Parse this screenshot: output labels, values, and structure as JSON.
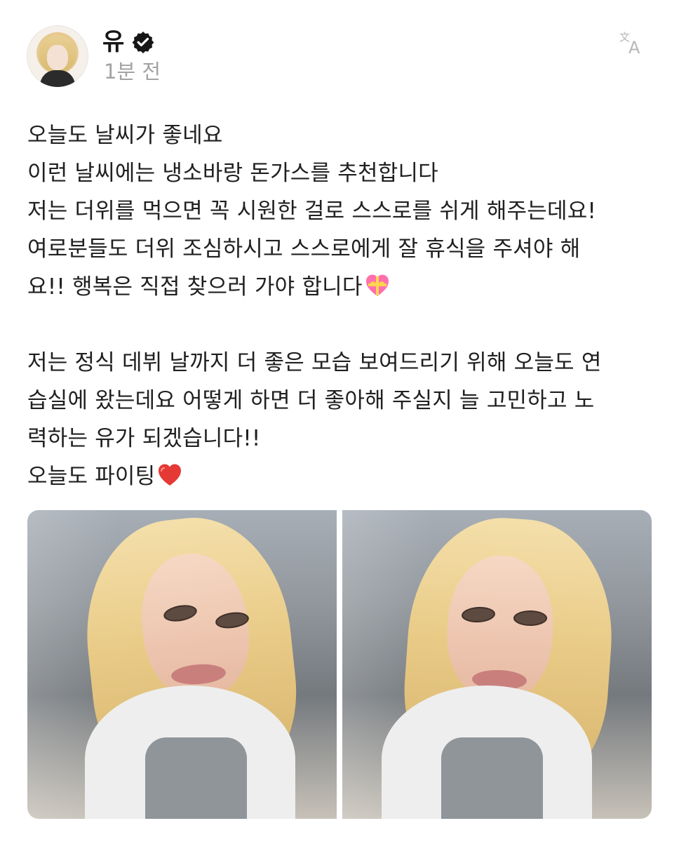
{
  "post": {
    "author_name": "유",
    "time_ago": "1분 전",
    "text_lines": [
      "오늘도 날씨가 좋네요",
      "이런 날씨에는 냉소바랑 돈가스를 추천합니다",
      "저는 더위를 먹으면 꼭 시원한 걸로 스스로를 쉬게 해주는데요!",
      "여로분들도 더위 조심하시고 스스로에게 잘 휴식을 주셔야 해",
      "요!! 행복은 직접 찾으러 가야 합니다",
      "",
      "저는 정식 데뷔 날까지 더 좋은 모습 보여드리기 위해 오늘도 연",
      "습실에 왔는데요 어떻게 하면 더 좋아해 주실지 늘 고민하고 노",
      "력하는 유가 되겠습니다!!",
      "오늘도 파이팅"
    ],
    "icons": {
      "verified": "verified-badge-icon",
      "translate": "translate-icon",
      "heart_gift": "heart-with-ribbon-icon",
      "red_heart": "red-heart-icon"
    },
    "colors": {
      "text": "#202020",
      "muted": "#a3a3a3",
      "icon_gray": "#b7b7b7",
      "heart_red": "#e53935",
      "gift_pink": "#ff7ab8",
      "gift_yellow": "#ffd54f"
    }
  }
}
